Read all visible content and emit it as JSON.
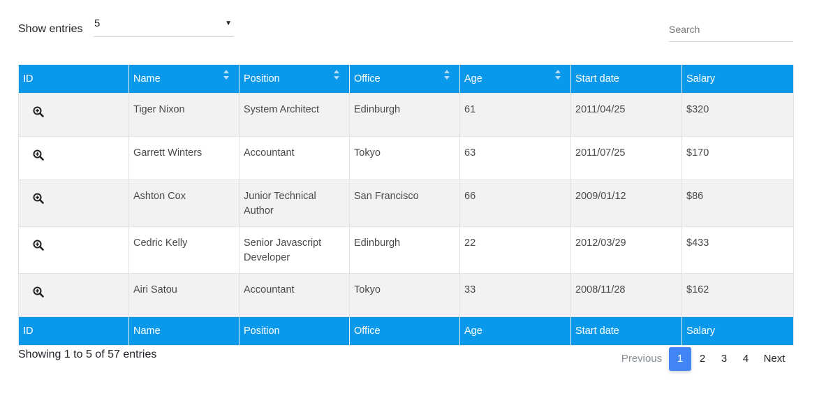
{
  "length_menu": {
    "label": "Show entries",
    "value": "5"
  },
  "search": {
    "placeholder": "Search"
  },
  "columns": [
    "ID",
    "Name",
    "Position",
    "Office",
    "Age",
    "Start date",
    "Salary"
  ],
  "rows": [
    {
      "name": "Tiger Nixon",
      "position": "System Architect",
      "office": "Edinburgh",
      "age": "61",
      "start_date": "2011/04/25",
      "salary": "$320"
    },
    {
      "name": "Garrett Winters",
      "position": "Accountant",
      "office": "Tokyo",
      "age": "63",
      "start_date": "2011/07/25",
      "salary": "$170"
    },
    {
      "name": "Ashton Cox",
      "position": "Junior Technical Author",
      "office": "San Francisco",
      "age": "66",
      "start_date": "2009/01/12",
      "salary": "$86"
    },
    {
      "name": "Cedric Kelly",
      "position": "Senior Javascript Developer",
      "office": "Edinburgh",
      "age": "22",
      "start_date": "2012/03/29",
      "salary": "$433"
    },
    {
      "name": "Airi Satou",
      "position": "Accountant",
      "office": "Tokyo",
      "age": "33",
      "start_date": "2008/11/28",
      "salary": "$162"
    }
  ],
  "row_icon": "zoom-in-icon",
  "info": "Showing 1 to 5 of 57 entries",
  "pagination": {
    "previous": "Previous",
    "pages": [
      "1",
      "2",
      "3",
      "4"
    ],
    "active": "1",
    "next": "Next"
  },
  "colors": {
    "header_bg": "#0a98ea",
    "active_page": "#4285f4",
    "striped_row": "#f2f2f2"
  }
}
